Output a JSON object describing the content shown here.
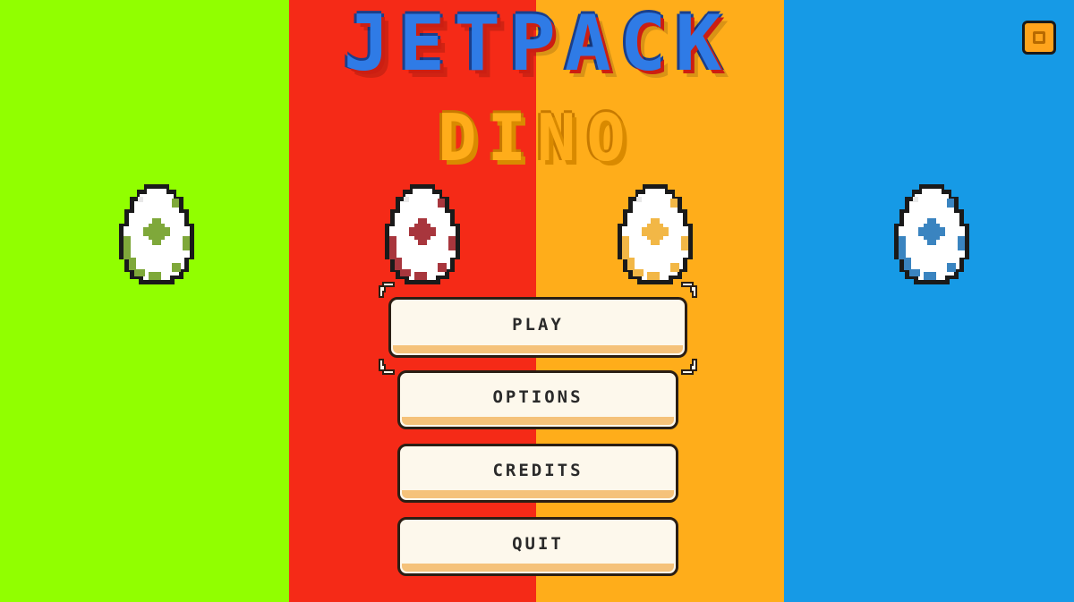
{
  "title": {
    "line1": "JETPACK",
    "line2": "DINO"
  },
  "colors": {
    "green_panel": "#91ff00",
    "red_panel": "#f52a17",
    "orange_panel": "#ffad1a",
    "blue_panel": "#169ae6",
    "title_blue": "#2f7be6",
    "title_blue_shadow": "#cc1e12",
    "title_orange": "#ffad1a",
    "title_orange_shadow": "#d98a00",
    "button_face": "#fdf8ec",
    "button_shade": "#f5c27a",
    "coin": "#ffa41c",
    "egg_green": "#7fa83a",
    "egg_red": "#a8363d",
    "egg_orange": "#f2b746",
    "egg_blue": "#3a84c0"
  },
  "menu": {
    "play_label": "PLAY",
    "options_label": "OPTIONS",
    "credits_label": "CREDITS",
    "quit_label": "QUIT",
    "selected": "PLAY"
  },
  "icons": {
    "coin": "coin-icon",
    "egg": "egg-icon",
    "selector": "selector-bracket-icon"
  }
}
